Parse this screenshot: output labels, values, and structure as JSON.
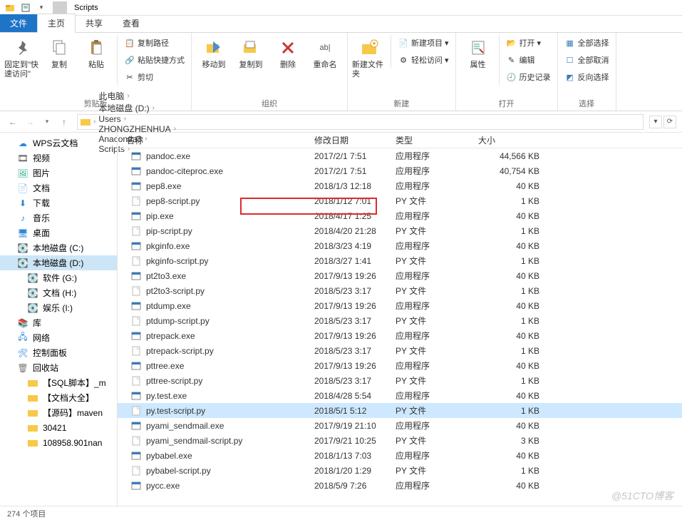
{
  "window": {
    "title": "Scripts"
  },
  "tabs": {
    "file": "文件",
    "home": "主页",
    "share": "共享",
    "view": "查看"
  },
  "ribbon": {
    "clipboard": {
      "pin": "固定到\"快速访问\"",
      "copy": "复制",
      "paste": "粘贴",
      "copy_path": "复制路径",
      "paste_shortcut": "粘贴快捷方式",
      "cut": "剪切",
      "label": "剪贴板"
    },
    "organize": {
      "moveto": "移动到",
      "copyto": "复制到",
      "delete": "删除",
      "rename": "重命名",
      "label": "组织"
    },
    "new": {
      "newfolder": "新建文件夹",
      "newitem": "新建项目",
      "easyaccess": "轻松访问",
      "label": "新建"
    },
    "open": {
      "props": "属性",
      "open": "打开",
      "edit": "编辑",
      "history": "历史记录",
      "label": "打开"
    },
    "select": {
      "all": "全部选择",
      "none": "全部取消",
      "invert": "反向选择",
      "label": "选择"
    }
  },
  "path": {
    "segments": [
      "此电脑",
      "本地磁盘 (D:)",
      "Users",
      "ZHONGZHENHUA",
      "Anaconda3",
      "Scripts"
    ]
  },
  "tree": [
    {
      "icon": "cloud",
      "label": "WPS云文档"
    },
    {
      "icon": "video",
      "label": "视频"
    },
    {
      "icon": "image",
      "label": "图片"
    },
    {
      "icon": "doc",
      "label": "文档"
    },
    {
      "icon": "down",
      "label": "下载"
    },
    {
      "icon": "music",
      "label": "音乐"
    },
    {
      "icon": "desk",
      "label": "桌面"
    },
    {
      "icon": "disk",
      "label": "本地磁盘 (C:)"
    },
    {
      "icon": "disk",
      "label": "本地磁盘 (D:)",
      "selected": true
    },
    {
      "icon": "disk",
      "label": "软件 (G:)",
      "indent": true
    },
    {
      "icon": "disk",
      "label": "文档 (H:)",
      "indent": true
    },
    {
      "icon": "disk",
      "label": "娱乐 (I:)",
      "indent": true
    },
    {
      "icon": "lib",
      "label": "库"
    },
    {
      "icon": "net",
      "label": "网络"
    },
    {
      "icon": "ctrl",
      "label": "控制面板"
    },
    {
      "icon": "bin",
      "label": "回收站"
    },
    {
      "icon": "folder",
      "label": "【SQL脚本】_m",
      "indent": true
    },
    {
      "icon": "folder",
      "label": "【文档大全】",
      "indent": true
    },
    {
      "icon": "folder",
      "label": "【源码】maven",
      "indent": true
    },
    {
      "icon": "folder",
      "label": "30421",
      "indent": true
    },
    {
      "icon": "folder",
      "label": "108958.901nan",
      "indent": true
    }
  ],
  "headers": {
    "name": "名称",
    "date": "修改日期",
    "type": "类型",
    "size": "大小"
  },
  "files": [
    {
      "ic": "exe",
      "name": "pandoc.exe",
      "date": "2017/2/1 7:51",
      "type": "应用程序",
      "size": "44,566 KB"
    },
    {
      "ic": "exe",
      "name": "pandoc-citeproc.exe",
      "date": "2017/2/1 7:51",
      "type": "应用程序",
      "size": "40,754 KB"
    },
    {
      "ic": "exe",
      "name": "pep8.exe",
      "date": "2018/1/3 12:18",
      "type": "应用程序",
      "size": "40 KB"
    },
    {
      "ic": "py",
      "name": "pep8-script.py",
      "date": "2018/1/12 7:01",
      "type": "PY 文件",
      "size": "1 KB"
    },
    {
      "ic": "exe",
      "name": "pip.exe",
      "date": "2018/4/17 1:25",
      "type": "应用程序",
      "size": "40 KB"
    },
    {
      "ic": "py",
      "name": "pip-script.py",
      "date": "2018/4/20 21:28",
      "type": "PY 文件",
      "size": "1 KB"
    },
    {
      "ic": "exe",
      "name": "pkginfo.exe",
      "date": "2018/3/23 4:19",
      "type": "应用程序",
      "size": "40 KB"
    },
    {
      "ic": "py",
      "name": "pkginfo-script.py",
      "date": "2018/3/27 1:41",
      "type": "PY 文件",
      "size": "1 KB"
    },
    {
      "ic": "exe",
      "name": "pt2to3.exe",
      "date": "2017/9/13 19:26",
      "type": "应用程序",
      "size": "40 KB"
    },
    {
      "ic": "py",
      "name": "pt2to3-script.py",
      "date": "2018/5/23 3:17",
      "type": "PY 文件",
      "size": "1 KB"
    },
    {
      "ic": "exe",
      "name": "ptdump.exe",
      "date": "2017/9/13 19:26",
      "type": "应用程序",
      "size": "40 KB"
    },
    {
      "ic": "py",
      "name": "ptdump-script.py",
      "date": "2018/5/23 3:17",
      "type": "PY 文件",
      "size": "1 KB"
    },
    {
      "ic": "exe",
      "name": "ptrepack.exe",
      "date": "2017/9/13 19:26",
      "type": "应用程序",
      "size": "40 KB"
    },
    {
      "ic": "py",
      "name": "ptrepack-script.py",
      "date": "2018/5/23 3:17",
      "type": "PY 文件",
      "size": "1 KB"
    },
    {
      "ic": "exe",
      "name": "pttree.exe",
      "date": "2017/9/13 19:26",
      "type": "应用程序",
      "size": "40 KB"
    },
    {
      "ic": "py",
      "name": "pttree-script.py",
      "date": "2018/5/23 3:17",
      "type": "PY 文件",
      "size": "1 KB"
    },
    {
      "ic": "exe",
      "name": "py.test.exe",
      "date": "2018/4/28 5:54",
      "type": "应用程序",
      "size": "40 KB"
    },
    {
      "ic": "py",
      "name": "py.test-script.py",
      "date": "2018/5/1 5:12",
      "type": "PY 文件",
      "size": "1 KB",
      "selected": true
    },
    {
      "ic": "exe",
      "name": "pyami_sendmail.exe",
      "date": "2017/9/19 21:10",
      "type": "应用程序",
      "size": "40 KB"
    },
    {
      "ic": "py",
      "name": "pyami_sendmail-script.py",
      "date": "2017/9/21 10:25",
      "type": "PY 文件",
      "size": "3 KB"
    },
    {
      "ic": "exe",
      "name": "pybabel.exe",
      "date": "2018/1/13 7:03",
      "type": "应用程序",
      "size": "40 KB"
    },
    {
      "ic": "py",
      "name": "pybabel-script.py",
      "date": "2018/1/20 1:29",
      "type": "PY 文件",
      "size": "1 KB"
    },
    {
      "ic": "exe",
      "name": "pycc.exe",
      "date": "2018/5/9 7:26",
      "type": "应用程序",
      "size": "40 KB"
    }
  ],
  "status": {
    "count": "274 个项目"
  },
  "watermark": "@51CTO博客"
}
